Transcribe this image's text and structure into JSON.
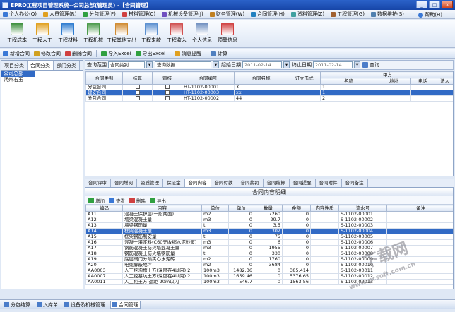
{
  "window": {
    "title": "EPRO工程项目管理系统--公司总部(管理员) -【合同管理】",
    "controls": [
      "_",
      "□",
      "×"
    ]
  },
  "menu": [
    {
      "label": "个人办公(Q)",
      "color": "#3a78d6"
    },
    {
      "label": "人员管理(R)",
      "color": "#e0a020"
    },
    {
      "label": "分包管理(F)",
      "color": "#30a040"
    },
    {
      "label": "材料管理(C)",
      "color": "#d04040"
    },
    {
      "label": "机械设备管理(J)",
      "color": "#7050c0"
    },
    {
      "label": "财务管理(W)",
      "color": "#c08020"
    },
    {
      "label": "合同管理(H)",
      "color": "#2080c0"
    },
    {
      "label": "资料管理(Z)",
      "color": "#40a0a0"
    },
    {
      "label": "工程管理(G)",
      "color": "#a06030"
    },
    {
      "label": "数据维护(S)",
      "color": "#5080b0"
    }
  ],
  "help": "帮助(H)",
  "toolbar": [
    "工程成本",
    "工程人工",
    "工程材料",
    "工程机械",
    "工程其他支出",
    "工程来款",
    "工程收入",
    "个人信息",
    "预警信息"
  ],
  "subtoolbar": [
    "新增合同",
    "修改合同",
    "删除合同",
    "导入Excel",
    "导出Excel",
    "消息提醒",
    "计算"
  ],
  "left": {
    "tabs": [
      "项目分类",
      "合同分类",
      "部门分类"
    ],
    "tree": [
      "公司总部",
      "朔州右玉"
    ]
  },
  "filter": {
    "range_label": "查询范围",
    "range_value": "合同类别",
    "field_value": "查询数据",
    "start_label": "起始日期",
    "start_date": "2011-02-14",
    "end_label": "终止日期",
    "end_date": "2011-02-14",
    "query_button": "查询"
  },
  "contracts": {
    "headers": [
      "合同类别",
      "结算",
      "审核",
      "合同编号",
      "合同名称",
      "订立形式",
      "甲方"
    ],
    "subheaders": [
      "名称",
      "地址",
      "电话",
      "法人"
    ],
    "rows": [
      {
        "category": "分包合同",
        "number": "HT-1102-00001",
        "name": "XL",
        "party": "1"
      },
      {
        "category": "建安合同",
        "number": "HT-1102-00003",
        "name": "xx",
        "party": "1"
      },
      {
        "category": "分包合同",
        "number": "HT-1102-00002",
        "name": "44",
        "party": "2"
      }
    ]
  },
  "bottom_tabs": [
    "合同评审",
    "合同增阅",
    "资质管理",
    "保证金",
    "合同内容",
    "合同付款",
    "合同奖罚",
    "合同结算",
    "合同提醒",
    "合同附件",
    "合同备注"
  ],
  "detail": {
    "title": "合同内容明细",
    "tools": [
      "增加",
      "查看",
      "删除",
      "导出"
    ],
    "headers": [
      "编码",
      "内容",
      "单位",
      "单价",
      "数量",
      "金额",
      "内容性质",
      "流水号",
      "备注"
    ],
    "rows": [
      [
        "A11",
        "混凝土保护层(一般两面)",
        "m2",
        "0",
        "7260",
        "0",
        "",
        "S-1102-00001",
        ""
      ],
      [
        "A12",
        "墙梁混凝土量",
        "m3",
        "0",
        "29.7",
        "0",
        "",
        "S-1102-00002",
        ""
      ],
      [
        "A13",
        "墙梁钢筋量",
        "t",
        "0",
        "3.5",
        "0",
        "",
        "S-1102-00003",
        ""
      ],
      [
        "A14",
        "框架混凝土量",
        "m3",
        "0",
        "302",
        "0",
        "",
        "S-1102-00004",
        ""
      ],
      [
        "A15",
        "框架钢筋制安量",
        "t",
        "0",
        "75",
        "0",
        "",
        "S-1102-00005",
        ""
      ],
      [
        "A16",
        "混凝土灌浆料(C60无收缩水泥砂浆)",
        "m3",
        "0",
        "6",
        "0",
        "",
        "S-1102-00006",
        ""
      ],
      [
        "A17",
        "钢筋混凝土防火墙混凝土量",
        "m3",
        "0",
        "1955",
        "0",
        "",
        "S-1102-00007",
        ""
      ],
      [
        "A18",
        "钢筋混凝土防火墙钢筋量",
        "t",
        "0",
        "330",
        "0",
        "",
        "S-1102-00008",
        ""
      ],
      [
        "A19",
        "底层阀门分隔实心水泥砖",
        "m2",
        "0",
        "1760",
        "0",
        "",
        "S-1102-00009",
        ""
      ],
      [
        "A20",
        "电缆屏蔽地坪",
        "m2",
        "0",
        "3684",
        "0",
        "",
        "S-1102-00010",
        ""
      ],
      [
        "AA0003",
        "人工挖沟槽土方(深度在4以内) 2",
        "100m3",
        "1482.36",
        "0",
        "385.414",
        "",
        "S-1102-00011",
        ""
      ],
      [
        "AA0007",
        "人工挖基坑土方(深度在4以内) 2",
        "100m3",
        "1659.46",
        "0",
        "5376.65",
        "",
        "S-1102-00012",
        ""
      ],
      [
        "AA0011",
        "人工挖土方 运距 20m以内",
        "100m3",
        "546.7",
        "0",
        "1563.56",
        "",
        "S-1102-00013",
        ""
      ]
    ]
  },
  "status": [
    "分包结算",
    "入库单",
    "设备及机械管理",
    "合同管理"
  ],
  "watermark": {
    "cn": "下载网",
    "url": "www.pcsoft.com.cn"
  }
}
